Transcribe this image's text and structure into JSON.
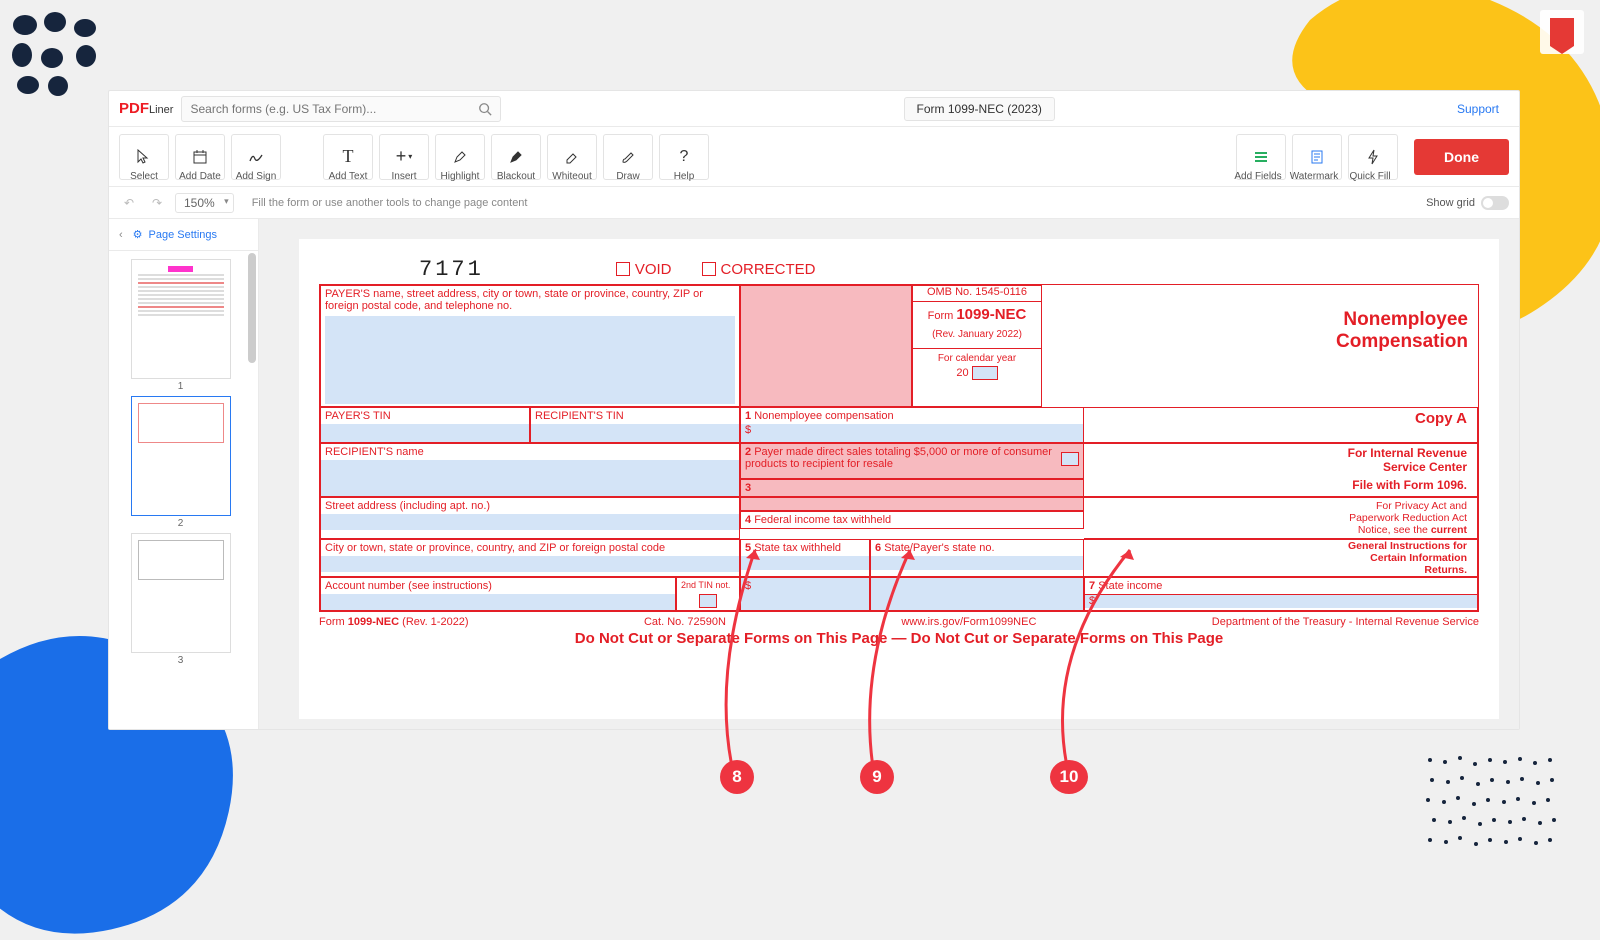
{
  "header": {
    "logo_prefix": "PDF",
    "logo_suffix": "Liner",
    "search_placeholder": "Search forms (e.g. US Tax Form)...",
    "doc_title": "Form 1099-NEC (2023)",
    "support": "Support"
  },
  "toolbar": {
    "select": "Select",
    "add_date": "Add Date",
    "add_sign": "Add Sign",
    "add_text": "Add Text",
    "insert": "Insert",
    "highlight": "Highlight",
    "blackout": "Blackout",
    "whiteout": "Whiteout",
    "draw": "Draw",
    "help": "Help",
    "add_fields": "Add Fields",
    "watermark": "Watermark",
    "quick_fill": "Quick Fill",
    "done": "Done"
  },
  "subbar": {
    "zoom": "150%",
    "hint": "Fill the form or use another tools to change page content",
    "show_grid": "Show grid"
  },
  "sidebar": {
    "page_settings": "Page Settings",
    "thumb1": "1",
    "thumb2": "2",
    "thumb3": "3"
  },
  "form": {
    "code": "7171",
    "void": "VOID",
    "corrected": "CORRECTED",
    "payer_label": "PAYER'S name, street address, city or town, state or province, country, ZIP or foreign postal code, and telephone no.",
    "omb": "OMB No. 1545-0116",
    "form_word": "Form",
    "form_num": "1099-NEC",
    "rev": "(Rev. January 2022)",
    "cal_year": "For calendar year",
    "year_prefix": "20",
    "title1": "Nonemployee",
    "title2": "Compensation",
    "payer_tin": "PAYER'S TIN",
    "recip_tin": "RECIPIENT'S TIN",
    "box1_num": "1",
    "box1_lbl": "Nonemployee compensation",
    "dollar": "$",
    "recip_name": "RECIPIENT'S name",
    "box2_num": "2",
    "box2_lbl": "Payer made direct sales totaling $5,000 or more of consumer products to recipient for resale",
    "box3_num": "3",
    "street": "Street address (including apt. no.)",
    "box4_num": "4",
    "box4_lbl": "Federal income tax withheld",
    "city_row": "City or town, state or province, country, and ZIP or foreign postal code",
    "box5_num": "5",
    "box5_lbl": "State tax withheld",
    "box6_num": "6",
    "box6_lbl": "State/Payer's state no.",
    "box7_num": "7",
    "box7_lbl": "State income",
    "acct": "Account number (see instructions)",
    "tin2": "2nd TIN not.",
    "copy_a": "Copy A",
    "copy_a_line1": "For Internal Revenue",
    "copy_a_line2": "Service Center",
    "file_with": "File with Form 1096.",
    "notice1": "For Privacy Act and",
    "notice2": "Paperwork Reduction Act",
    "notice3": "Notice, see the ",
    "notice3b": "current",
    "notice4": "General Instructions for",
    "notice5": "Certain Information",
    "notice6": "Returns.",
    "footer_form": "Form",
    "footer_num": "1099-NEC",
    "footer_rev": "(Rev. 1-2022)",
    "cat": "Cat. No. 72590N",
    "url": "www.irs.gov/Form1099NEC",
    "dept": "Department of the Treasury - Internal Revenue Service",
    "warning": "Do Not Cut or Separate Forms on This Page   —   Do Not Cut or Separate Forms on This Page"
  },
  "annotations": {
    "a8": "8",
    "a9": "9",
    "a10": "10"
  }
}
